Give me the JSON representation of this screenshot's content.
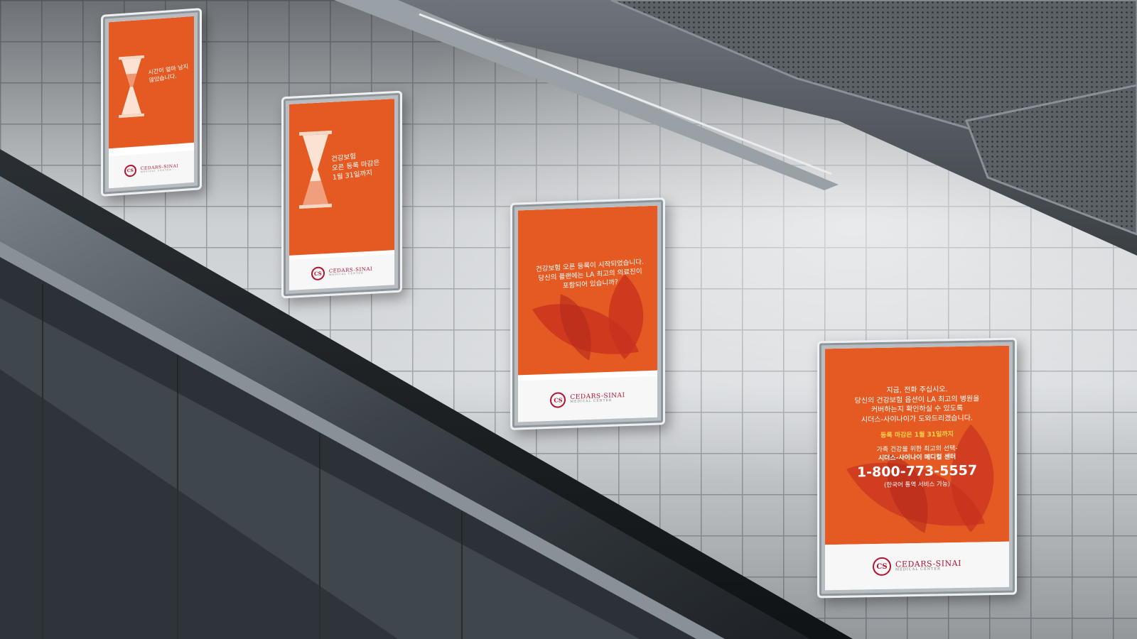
{
  "posters": [
    {
      "id": "poster-1",
      "headline": "시간이 얼마 남지 않았습니다.",
      "logo_name": "CEDARS-SINAI",
      "logo_sub": "MEDICAL CENTER",
      "logo_monogram": "CS"
    },
    {
      "id": "poster-2",
      "headline_lines": [
        "건강보험",
        "오픈 등록 마감은",
        "1월 31일까지"
      ],
      "logo_name": "CEDARS-SINAI",
      "logo_sub": "MEDICAL CENTER",
      "logo_monogram": "CS"
    },
    {
      "id": "poster-3",
      "headline_lines": [
        "건강보험 오픈 등록이 시작되었습니다.",
        "당신의 플랜에는 LA 최고의 의료진이",
        "포함되어 있습니까?"
      ],
      "logo_name": "CEDARS-SINAI",
      "logo_sub": "MEDICAL CENTER",
      "logo_monogram": "CS"
    },
    {
      "id": "poster-4",
      "headline_lines": [
        "지금, 전화 주십시오.",
        "당신의 건강보험 옵션이 LA 최고의 병원을",
        "커버하는지 확인하실 수 있도록",
        "시더스-사이나이가 도와드리겠습니다."
      ],
      "deadline": "등록 마감은 1월 31일까지",
      "tagline_lines": [
        "가족 건강을 위한 최고의 선택-",
        "시더스-사이나이 메디컬 센터"
      ],
      "phone": "1-800-773-5557",
      "note": "(한국어 통역 서비스 가능)",
      "logo_name": "CEDARS-SINAI",
      "logo_sub": "MEDICAL CENTER",
      "logo_monogram": "CS"
    }
  ],
  "colors": {
    "poster_orange": "#e55a22",
    "logo_red": "#b3132f",
    "deadline_yellow": "#ffd24a",
    "wall": "#d8dbde"
  }
}
